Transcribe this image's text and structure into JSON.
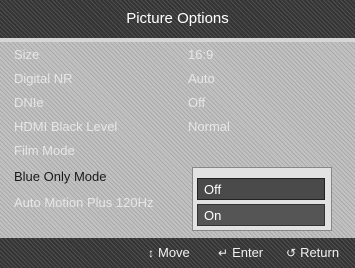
{
  "title": "Picture Options",
  "menu": {
    "rows": [
      {
        "label": "Size",
        "value": "16:9"
      },
      {
        "label": "Digital NR",
        "value": "Auto"
      },
      {
        "label": "DNIe",
        "value": "Off"
      },
      {
        "label": "HDMI Black Level",
        "value": "Normal"
      },
      {
        "label": "Film Mode",
        "value": ""
      },
      {
        "label": "Blue Only Mode",
        "value": ""
      },
      {
        "label": "Auto Motion Plus 120Hz",
        "value": ""
      }
    ]
  },
  "dropdown": {
    "options": [
      "Off",
      "On"
    ],
    "selected": "Off"
  },
  "footer": {
    "move_icon": "updown-icon",
    "move": "Move",
    "enter_icon": "enter-icon",
    "enter": "Enter",
    "return_icon": "return-icon",
    "return": "Return"
  }
}
